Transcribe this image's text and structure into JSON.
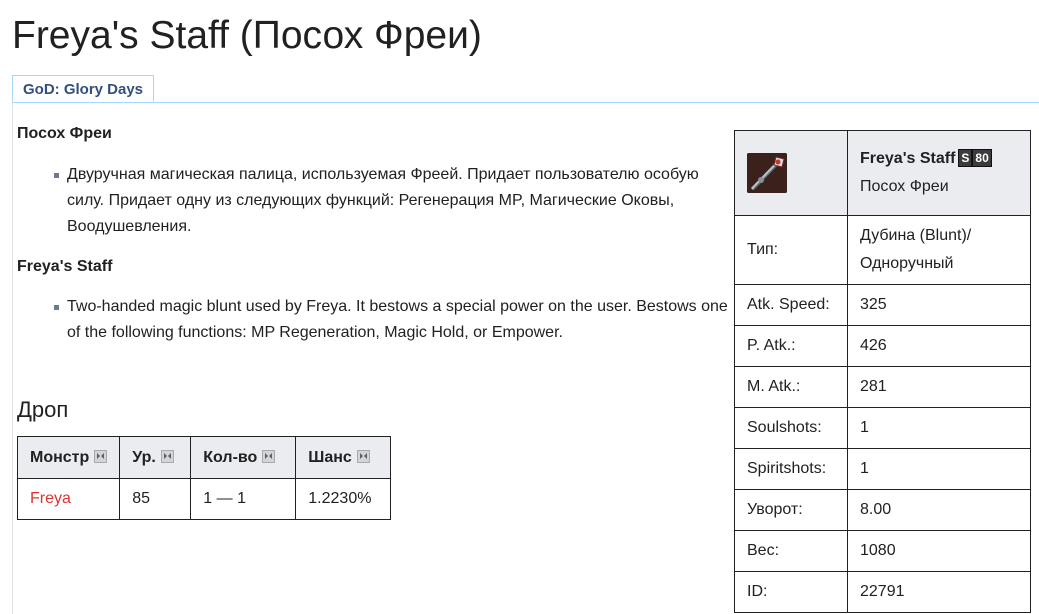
{
  "title": "Freya's Staff (Посох Фреи)",
  "tab": {
    "label": "GoD: Glory Days"
  },
  "descriptions": [
    {
      "heading": "Посох Фреи",
      "text": "Двуручная магическая палица, используемая Фреей. Придает пользователю особую силу. Придает одну из следующих функций: Регенерация MP, Магические Оковы, Воодушевления."
    },
    {
      "heading": "Freya's Staff",
      "text": "Two-handed magic blunt used by Freya. It bestows a special power on the user. Bestows one of the following functions: MP Regeneration, Magic Hold, or Empower."
    }
  ],
  "drop": {
    "heading": "Дроп",
    "columns": [
      "Монстр",
      "Ур.",
      "Кол-во",
      "Шанс"
    ],
    "rows": [
      {
        "monster": "Freya",
        "level": "85",
        "quantity": "1 — 1",
        "chance": "1.2230%"
      }
    ]
  },
  "infobox": {
    "icon": "staff-icon",
    "name_en": "Freya's Staff",
    "grade": "S",
    "grade_level": "80",
    "name_ru": "Посох Фреи",
    "rows": [
      {
        "label": "Тип:",
        "value": "Дубина (Blunt)/ Одноручный"
      },
      {
        "label": "Atk. Speed:",
        "value": "325"
      },
      {
        "label": "P. Atk.:",
        "value": "426"
      },
      {
        "label": "M. Atk.:",
        "value": "281"
      },
      {
        "label": "Soulshots:",
        "value": "1"
      },
      {
        "label": "Spiritshots:",
        "value": "1"
      },
      {
        "label": "Уворот:",
        "value": "8.00"
      },
      {
        "label": "Вес:",
        "value": "1080"
      },
      {
        "label": "ID:",
        "value": "22791"
      }
    ]
  },
  "colors": {
    "link_red": "#dd3333",
    "tab_text": "#334f7c",
    "header_bg": "#eaecf0"
  }
}
